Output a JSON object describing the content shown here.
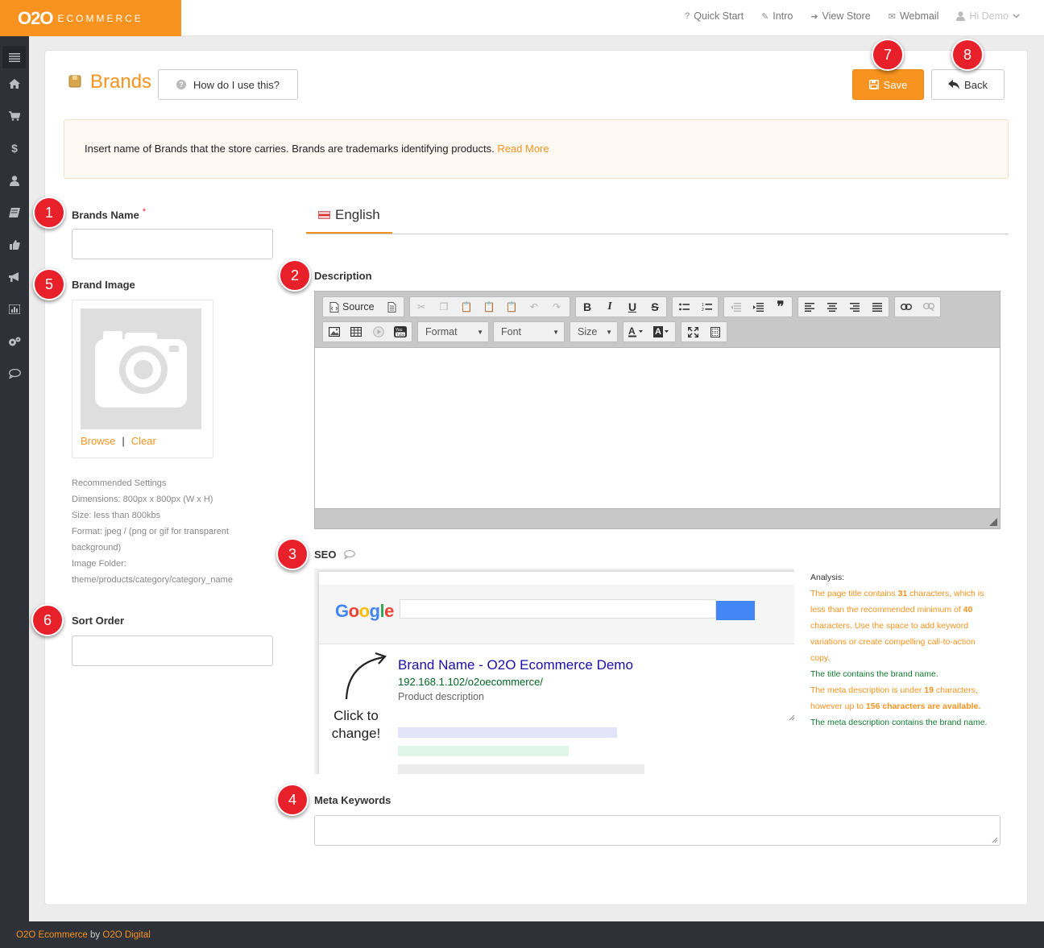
{
  "brand": {
    "big": "O2O",
    "small": "ECOMMERCE"
  },
  "topnav": [
    {
      "icon": "?",
      "label": "Quick Start"
    },
    {
      "icon": "✎",
      "label": "Intro"
    },
    {
      "icon": "➜",
      "label": "View Store"
    },
    {
      "icon": "✉",
      "label": "Webmail"
    }
  ],
  "user": {
    "label": "Hi Demo"
  },
  "page": {
    "title": "Brands",
    "help_label": "How do I use this?",
    "save_label": "Save",
    "back_label": "Back"
  },
  "info": {
    "text": "Insert name of Brands that the store carries. Brands are trademarks identifying products.",
    "link": "Read More"
  },
  "badges": [
    "1",
    "2",
    "3",
    "4",
    "5",
    "6",
    "7",
    "8"
  ],
  "form": {
    "brands_name_label": "Brands Name",
    "required_mark": "*",
    "brand_image_label": "Brand Image",
    "browse_label": "Browse",
    "separator": "|",
    "clear_label": "Clear",
    "recommended": [
      "Recommended Settings",
      "Dimensions: 800px x 800px (W x H)",
      "Size: less than 800kbs",
      "Format: jpeg / (png or gif for transparent",
      "background)",
      "Image Folder:",
      "theme/products/category/category_name"
    ],
    "sort_order_label": "Sort Order",
    "description_label": "Description",
    "seo_label": "SEO",
    "meta_keywords_label": "Meta Keywords"
  },
  "tabs": [
    {
      "label": "English"
    }
  ],
  "editor": {
    "source_label": "Source",
    "format_label": "Format",
    "font_label": "Font",
    "size_label": "Size"
  },
  "seo": {
    "google": "Google",
    "title": "Brand Name - O2O Ecommerce Demo",
    "url": "192.168.1.102/o2oecommerce/",
    "description": "Product description",
    "click_change_1": "Click to",
    "click_change_2": "change!"
  },
  "analysis": {
    "heading": "Analysis:",
    "p1_a": "The page title contains ",
    "p1_num": "31",
    "p1_b": " characters, which is less than the recommended minimum of ",
    "p1_num2": "40",
    "p1_c": " characters. Use the space to add keyword variations or create compelling call-to-action copy.",
    "p2": "The title contains the brand name.",
    "p3_a": "The meta description is under ",
    "p3_num": "19",
    "p3_b": " characters, however up to ",
    "p3_num2": "156 characters are available.",
    "p4": "The meta description contains the brand name."
  },
  "footer": {
    "brand": "O2O Ecommerce",
    "by": " by ",
    "company": "O2O Digital"
  },
  "colors": {
    "accent": "#f7931e",
    "badge": "#e8202a",
    "sidebar": "#2e3238"
  }
}
